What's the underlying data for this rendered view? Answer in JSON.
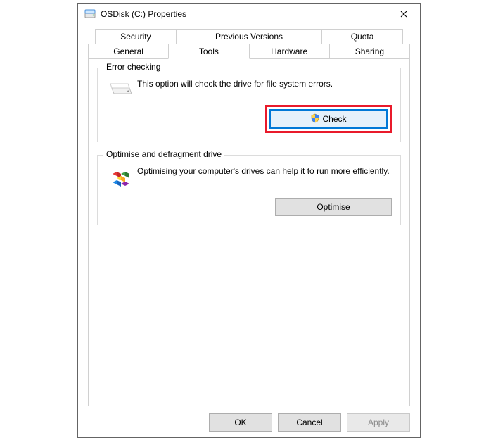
{
  "window": {
    "title": "OSDisk (C:) Properties"
  },
  "tabs": {
    "row_top": [
      {
        "label": "Security"
      },
      {
        "label": "Previous Versions"
      },
      {
        "label": "Quota"
      }
    ],
    "row_bottom": [
      {
        "label": "General"
      },
      {
        "label": "Tools",
        "active": true
      },
      {
        "label": "Hardware"
      },
      {
        "label": "Sharing"
      }
    ]
  },
  "groups": {
    "error_checking": {
      "title": "Error checking",
      "description": "This option will check the drive for file system errors.",
      "button_label": "Check"
    },
    "optimise": {
      "title": "Optimise and defragment drive",
      "description": "Optimising your computer's drives can help it to run more efficiently.",
      "button_label": "Optimise"
    }
  },
  "dialog_buttons": {
    "ok": "OK",
    "cancel": "Cancel",
    "apply": "Apply"
  },
  "colors": {
    "annotation_red": "#e91a2b",
    "focus_blue": "#0078d7"
  }
}
